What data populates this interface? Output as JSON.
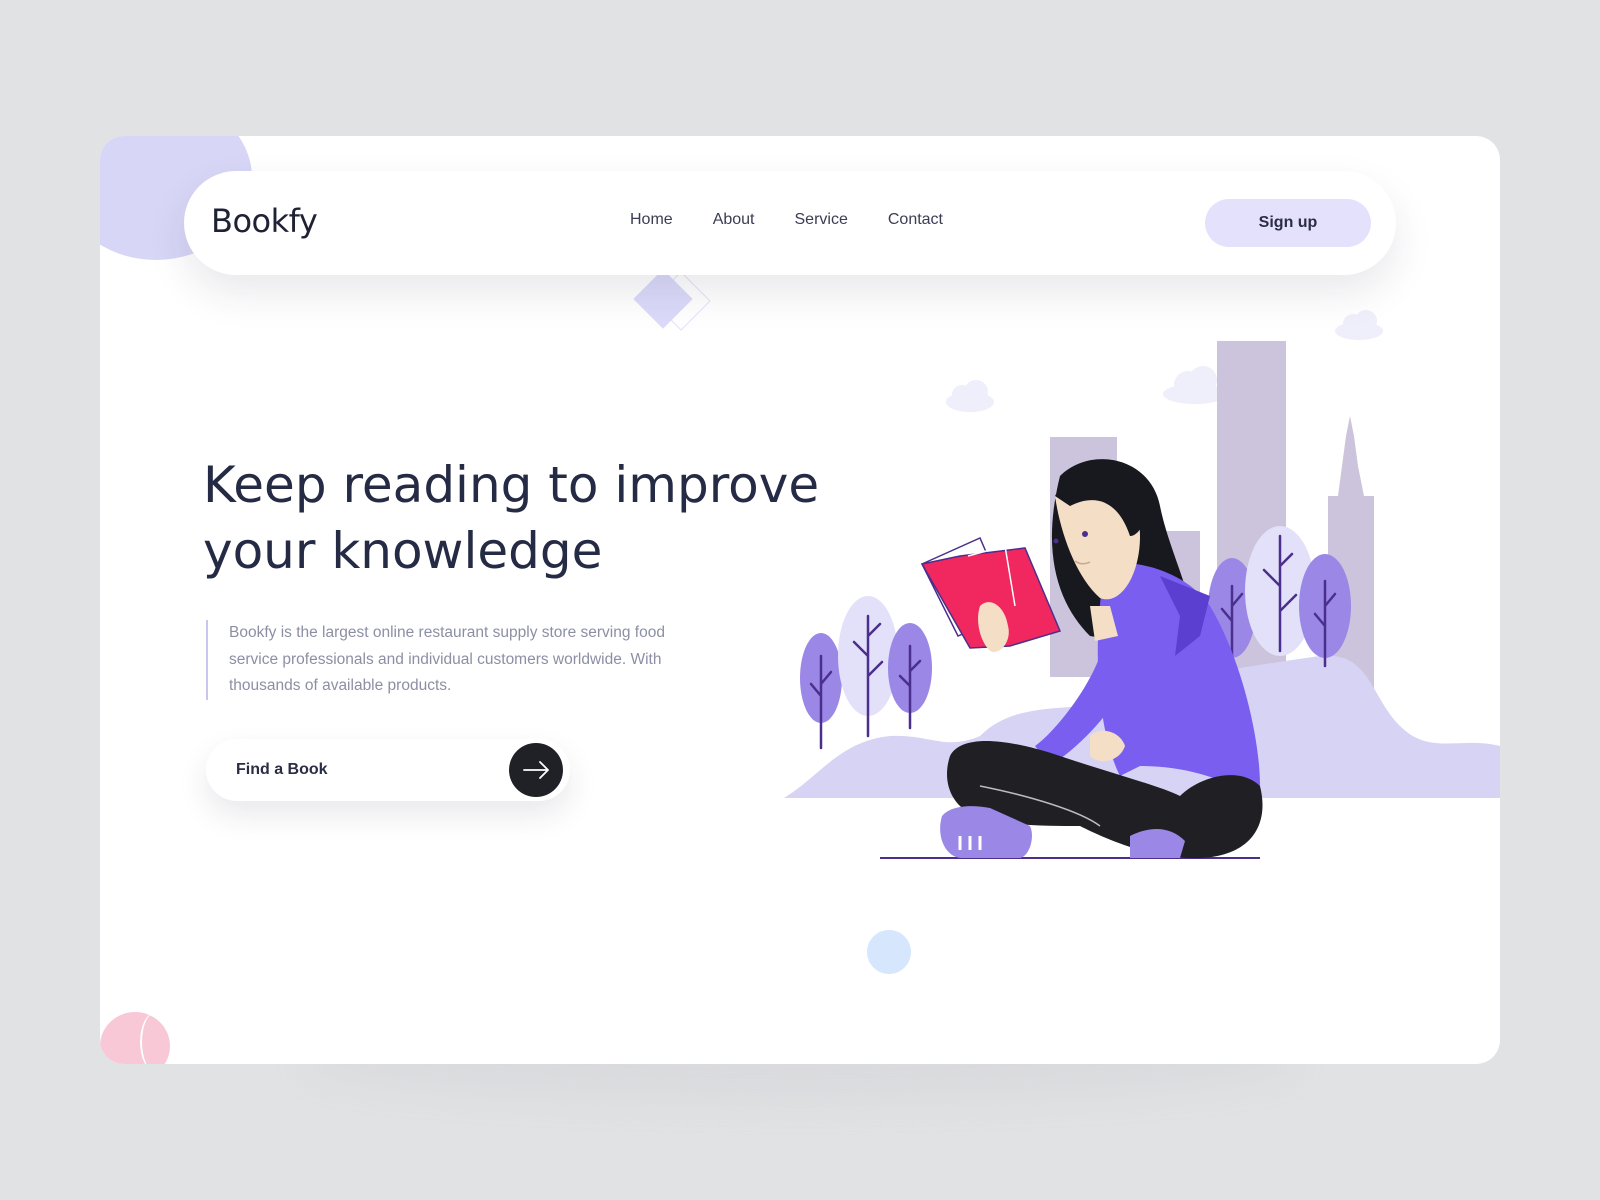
{
  "brand": {
    "logo": "Bookfy"
  },
  "nav": {
    "items": [
      {
        "label": "Home"
      },
      {
        "label": "About"
      },
      {
        "label": "Service"
      },
      {
        "label": "Contact"
      }
    ],
    "signup_label": "Sign up"
  },
  "hero": {
    "headline_line1": "Keep reading to improve",
    "headline_line2": "your knowledge",
    "description": "Bookfy is the largest online restaurant supply store serving food service professionals and individual customers worldwide. With thousands of available products.",
    "cta_label": "Find a Book"
  },
  "colors": {
    "accent_purple": "#7a5ef0",
    "soft_purple": "#d9d6f7",
    "book_pink": "#f0285f",
    "text_dark": "#252a45",
    "page_bg": "#e1e2e4"
  },
  "icons": {
    "cta_icon": "arrow-right-icon"
  }
}
